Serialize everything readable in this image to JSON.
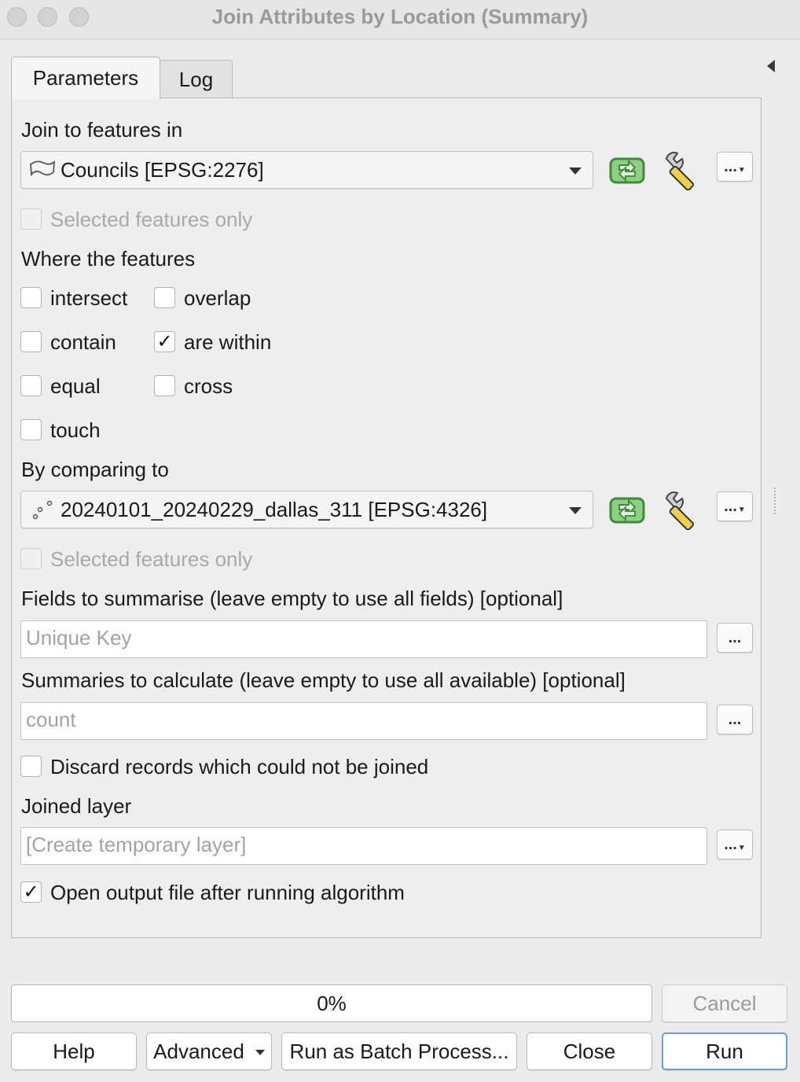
{
  "window": {
    "title": "Join Attributes by Location (Summary)"
  },
  "tabs": [
    {
      "label": "Parameters"
    },
    {
      "label": "Log"
    }
  ],
  "params": {
    "join_label": "Join to features in",
    "join_layer": "Councils [EPSG:2276]",
    "join_selected_only": "Selected features only",
    "predicate_label": "Where the features",
    "predicates": {
      "intersect": {
        "label": "intersect",
        "checked": false
      },
      "overlap": {
        "label": "overlap",
        "checked": false
      },
      "contain": {
        "label": "contain",
        "checked": false
      },
      "within": {
        "label": "are within",
        "checked": true
      },
      "equal": {
        "label": "equal",
        "checked": false
      },
      "cross": {
        "label": "cross",
        "checked": false
      },
      "touch": {
        "label": "touch",
        "checked": false
      }
    },
    "compare_label": "By comparing to",
    "compare_layer": "20240101_20240229_dallas_311 [EPSG:4326]",
    "compare_selected_only": "Selected features only",
    "fields_label": "Fields to summarise (leave empty to use all fields) [optional]",
    "fields_placeholder": "Unique Key",
    "summaries_label": "Summaries to calculate (leave empty to use all available) [optional]",
    "summaries_placeholder": "count",
    "discard_label": "Discard records which could not be joined",
    "discard_checked": false,
    "output_label": "Joined layer",
    "output_placeholder": "[Create temporary layer]",
    "open_output_label": "Open output file after running algorithm",
    "open_output_checked": true,
    "check_mark": "✓",
    "dots": "..."
  },
  "footer": {
    "progress_text": "0%",
    "progress_value": 0,
    "cancel": "Cancel",
    "help": "Help",
    "advanced": "Advanced",
    "batch": "Run as Batch Process...",
    "close": "Close",
    "run": "Run"
  },
  "colors": {
    "refresh_icon": "#5aa553",
    "wrench_handle": "#e8c33a",
    "default_button_border": "#6f9bd6"
  },
  "icons": [
    "polygon-layer-icon",
    "point-layer-icon",
    "refresh-icon",
    "wrench-icon",
    "chevron-down-icon",
    "collapse-arrow-icon"
  ]
}
